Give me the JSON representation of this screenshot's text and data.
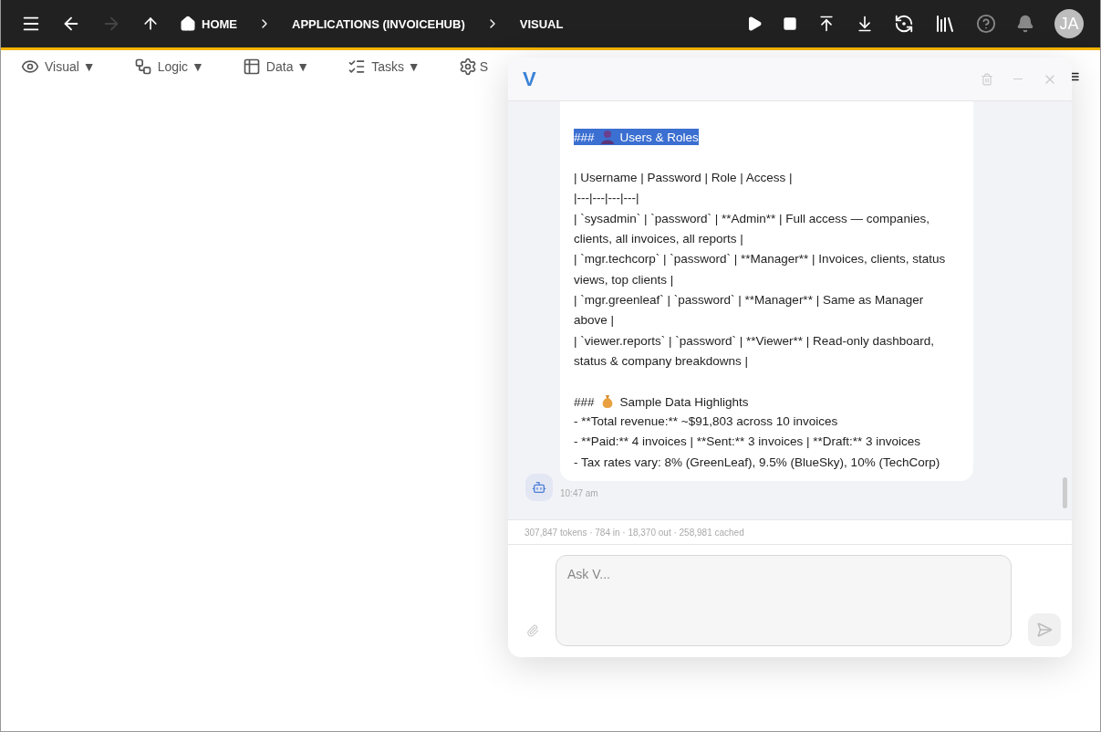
{
  "topbar": {
    "forward_disabled": true,
    "breadcrumbs": [
      "HOME",
      "APPLICATIONS (INVOICEHUB)",
      "VISUAL"
    ],
    "avatar": "JA"
  },
  "menus": [
    {
      "label": "Visual",
      "caret": "▼"
    },
    {
      "label": "Logic",
      "caret": "▼"
    },
    {
      "label": "Data",
      "caret": "▼"
    },
    {
      "label": "Tasks",
      "caret": "▼"
    },
    {
      "label": "S"
    }
  ],
  "chat": {
    "logo": "V",
    "sections": [
      {
        "marker": "###",
        "title": "Users & Roles",
        "selected": true,
        "lines": [
          "| Username | Password | Role | Access |",
          "|---|---|---|---|",
          "| `sysadmin` | `password` | **Admin** | Full access — companies, clients, all invoices, all reports |",
          "| `mgr.techcorp` | `password` | **Manager** | Invoices, clients, status views, top clients |",
          "| `mgr.greenleaf` | `password` | **Manager** | Same as Manager above |",
          "| `viewer.reports` | `password` | **Viewer** | Read-only dashboard, status & company breakdowns |"
        ]
      },
      {
        "marker": "###",
        "title": "Sample Data Highlights",
        "selected": false,
        "lines": [
          "- **Total revenue:** ~$91,803 across 10 invoices",
          "- **Paid:** 4 invoices | **Sent:** 3 invoices | **Draft:** 3 invoices",
          "- Tax rates vary: 8% (GreenLeaf), 9.5% (BlueSky), 10% (TechCorp)"
        ]
      }
    ],
    "time": "10:47 am",
    "usage": "307,847 tokens · 784 in · 18,370 out · 258,981 cached",
    "input": {
      "placeholder": "Ask V..."
    }
  }
}
